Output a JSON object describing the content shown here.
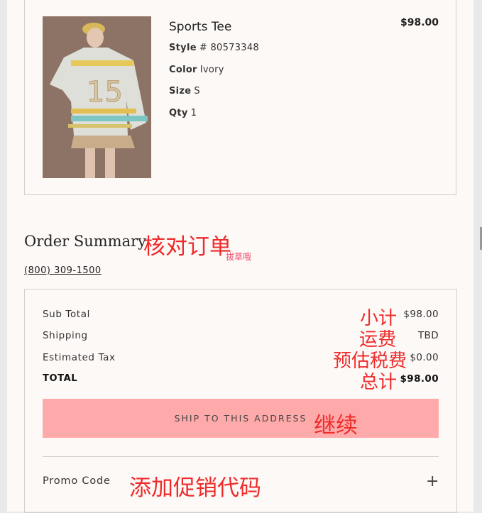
{
  "product": {
    "name": "Sports Tee",
    "price": "$98.00",
    "style_label": "Style",
    "style_value": "# 80573348",
    "color_label": "Color",
    "color_value": "Ivory",
    "size_label": "Size",
    "size_value": "S",
    "qty_label": "Qty",
    "qty_value": "1",
    "jersey_number": "15"
  },
  "summary": {
    "title": "Order Summary",
    "phone": "(800) 309-1500",
    "rows": [
      {
        "label": "Sub Total",
        "value": "$98.00"
      },
      {
        "label": "Shipping",
        "value": "TBD"
      },
      {
        "label": "Estimated Tax",
        "value": "$0.00"
      },
      {
        "label": "TOTAL",
        "value": "$98.00"
      }
    ],
    "ship_button": "SHIP TO THIS ADDRESS",
    "promo_label": "Promo Code",
    "promo_toggle": "+"
  },
  "annotations": {
    "order_summary": "核对订单",
    "watermark": "拔草哦",
    "subtotal": "小计",
    "shipping": "运费",
    "tax": "预估税费",
    "total": "总计",
    "continue": "继续",
    "promo": "添加促销代码"
  },
  "colors": {
    "button_bg": "#ffaaaa",
    "annotation": "#ef2b2b",
    "panel_bg": "#fdf9f7"
  }
}
